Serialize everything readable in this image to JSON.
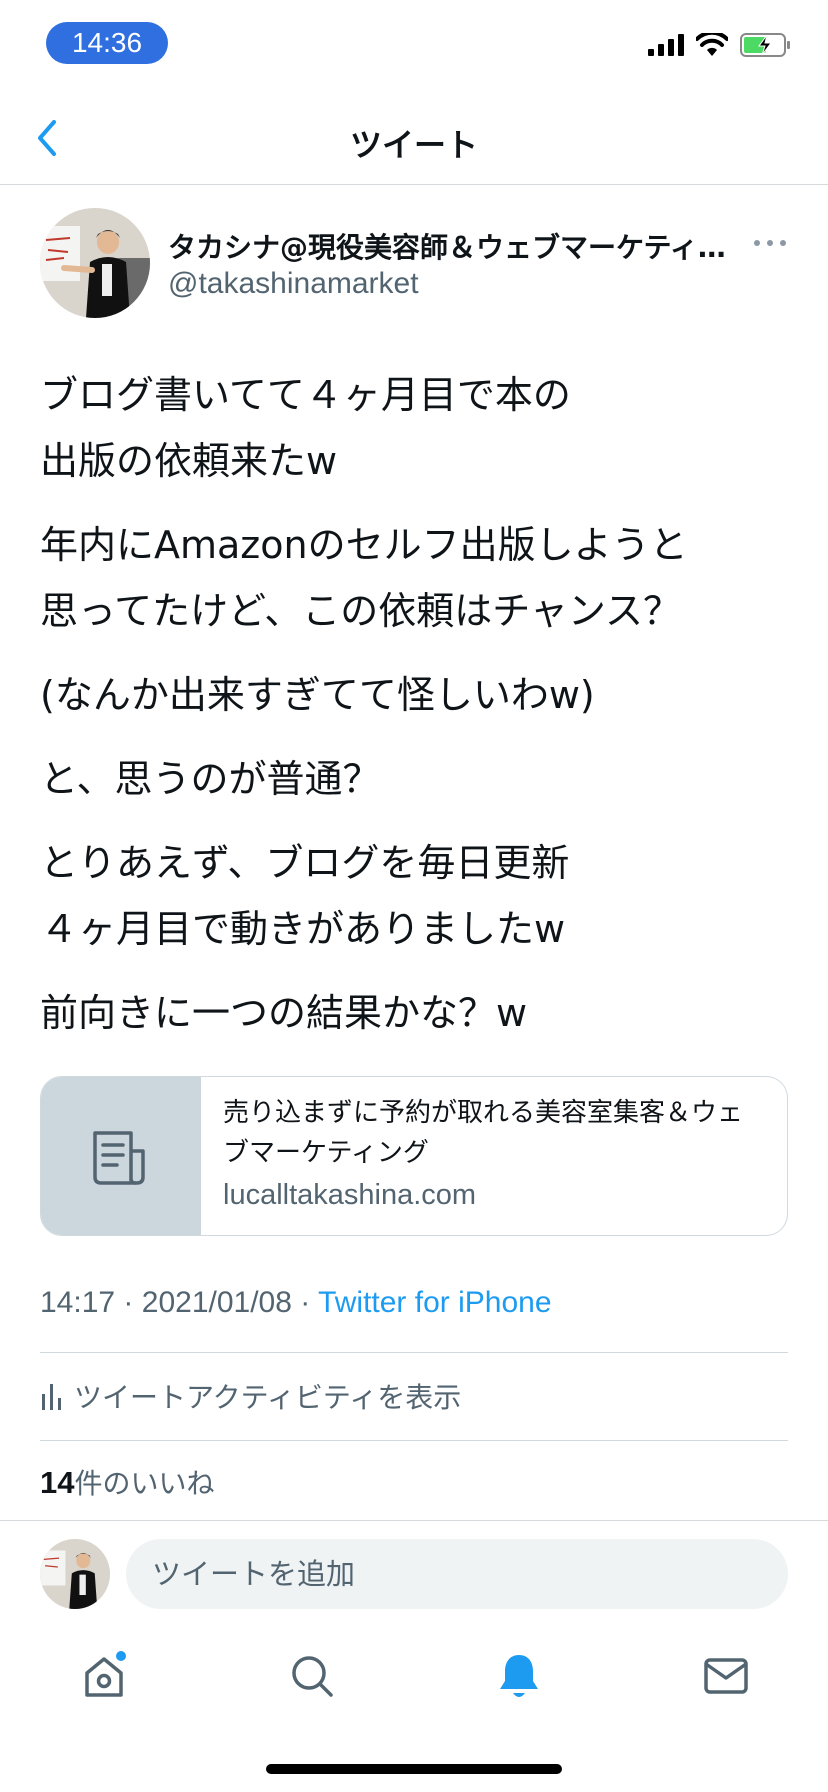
{
  "status_bar": {
    "time": "14:36"
  },
  "nav": {
    "title": "ツイート"
  },
  "author": {
    "name": "タカシナ@現役美容師＆ウェブマーケティング",
    "handle": "@takashinamarket"
  },
  "tweet": {
    "paragraphs": [
      "ブログ書いてて４ヶ月目で本の\n出版の依頼来たw",
      "年内にAmazonのセルフ出版しようと\n思ってたけど、この依頼はチャンス？",
      "(なんか出来すぎてて怪しいわw)",
      "と、思うのが普通？",
      "とりあえず、ブログを毎日更新\n４ヶ月目で動きがありましたw",
      "前向きに一つの結果かな？w"
    ]
  },
  "link_card": {
    "title": "売り込まずに予約が取れる美容室集客＆ウェブマーケティング",
    "domain": "lucalltakashina.com"
  },
  "meta": {
    "time": "14:17",
    "date": "2021/01/08",
    "separator": "·",
    "source": "Twitter for iPhone"
  },
  "activity": {
    "label": "ツイートアクティビティを表示"
  },
  "likes": {
    "count": "14",
    "label": "件のいいね"
  },
  "reply": {
    "placeholder": "ツイートを追加"
  },
  "tabs": [
    {
      "name": "home",
      "icon": "home-icon",
      "active": false,
      "has_dot": true
    },
    {
      "name": "search",
      "icon": "search-icon",
      "active": false
    },
    {
      "name": "notifications",
      "icon": "bell-icon",
      "active": true
    },
    {
      "name": "messages",
      "icon": "mail-icon",
      "active": false
    }
  ],
  "colors": {
    "accent": "#1d9bf0",
    "time_pill": "#2f6fe0",
    "secondary_text": "#536471",
    "battery_green": "#4cd964"
  }
}
